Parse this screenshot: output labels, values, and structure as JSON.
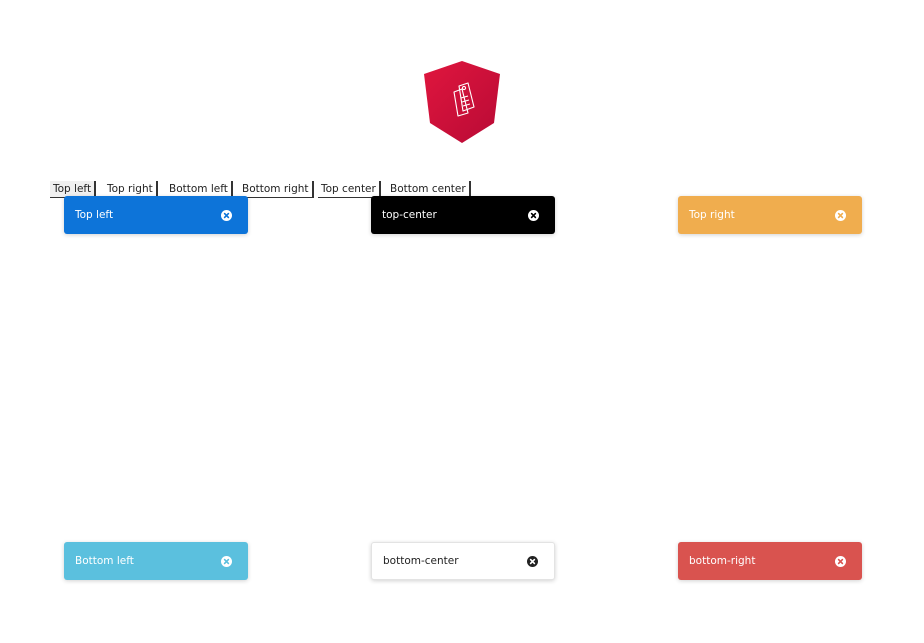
{
  "logo": {
    "icon": "price-tag-icon",
    "color": "#dd0031"
  },
  "position_buttons": [
    {
      "label": "Top left"
    },
    {
      "label": "Top right"
    },
    {
      "label": "Bottom left"
    },
    {
      "label": "Bottom right"
    },
    {
      "label": "Top center"
    },
    {
      "label": "Bottom center"
    }
  ],
  "toasts": {
    "top_left": {
      "message": "Top left",
      "bg": "#0d74d9",
      "fg": "#ffffff",
      "close_icon": "close-circle-icon"
    },
    "top_center": {
      "message": "top-center",
      "bg": "#000000",
      "fg": "#ffffff",
      "close_icon": "close-circle-icon"
    },
    "top_right": {
      "message": "Top right",
      "bg": "#f0ad4e",
      "fg": "#ffffff",
      "close_icon": "close-circle-icon"
    },
    "bottom_left": {
      "message": "Bottom left",
      "bg": "#5bc0de",
      "fg": "#ffffff",
      "close_icon": "close-circle-icon"
    },
    "bottom_center": {
      "message": "bottom-center",
      "bg": "#ffffff",
      "fg": "#222222",
      "close_icon": "close-circle-icon"
    },
    "bottom_right": {
      "message": "bottom-right",
      "bg": "#d9534f",
      "fg": "#ffffff",
      "close_icon": "close-circle-icon"
    }
  }
}
